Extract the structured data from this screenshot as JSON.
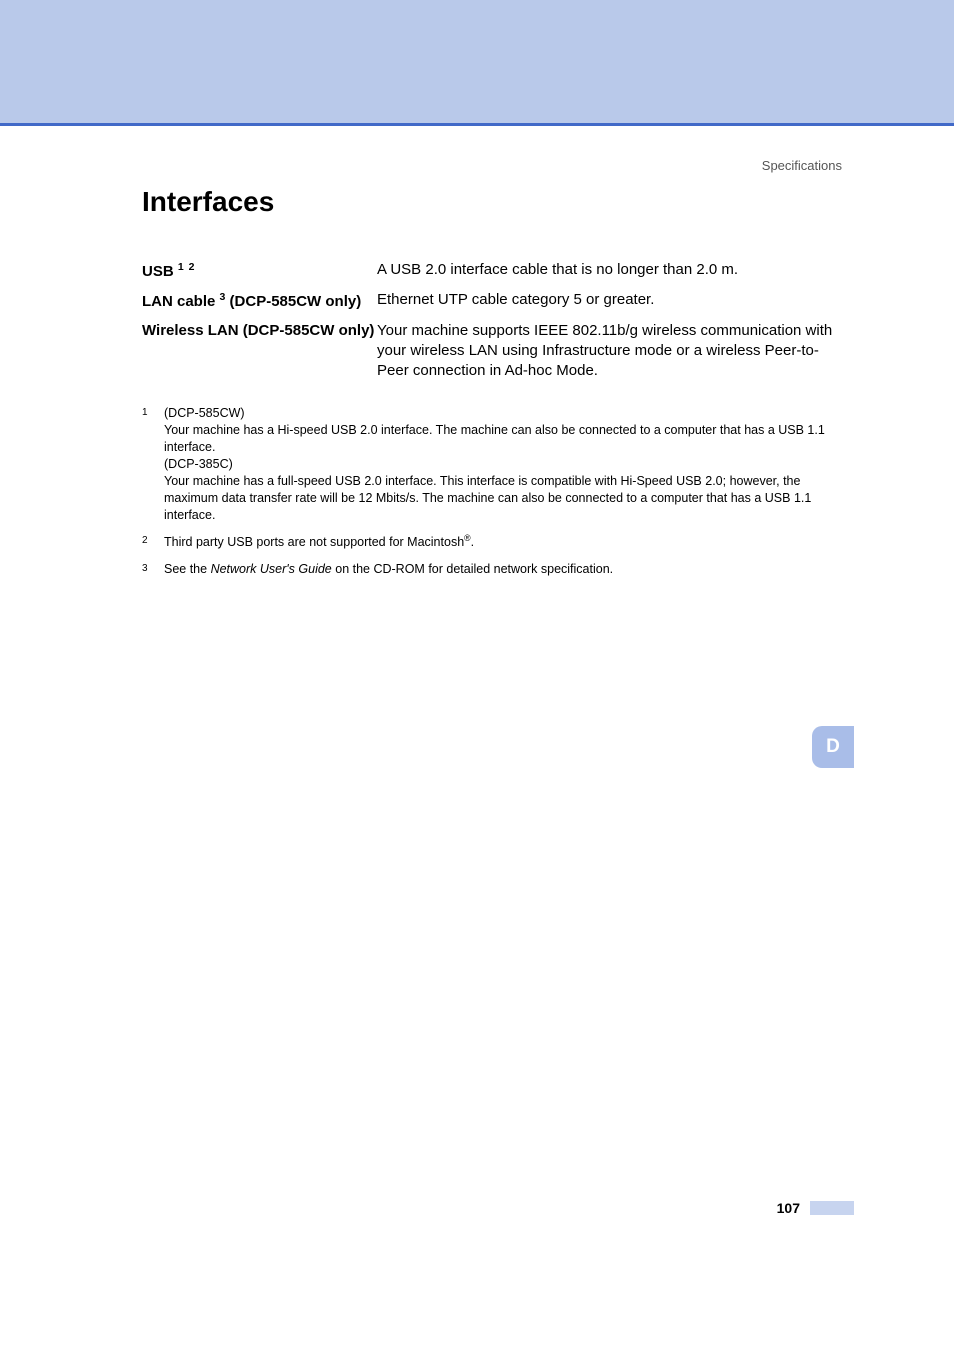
{
  "header": {
    "label": "Specifications"
  },
  "title": "Interfaces",
  "specs": [
    {
      "label": "USB",
      "label_sup": "1 2",
      "value": "A USB 2.0 interface cable that is no longer than 2.0 m."
    },
    {
      "label_pre": "LAN cable",
      "label_sup": "3",
      "label_post": " (DCP-585CW only)",
      "value": "Ethernet UTP cable category 5 or greater."
    },
    {
      "label": "Wireless LAN (DCP-585CW only)",
      "value": "Your machine supports IEEE 802.11b/g wireless communication with your wireless LAN using Infrastructure mode or a wireless Peer-to-Peer connection in Ad-hoc Mode."
    }
  ],
  "footnotes": [
    {
      "num": "1",
      "lines": [
        "(DCP-585CW)",
        "Your machine has a Hi-speed USB 2.0 interface. The machine can also be connected to a computer that has a USB 1.1 interface.",
        "(DCP-385C)",
        "Your machine has a full-speed USB 2.0 interface. This interface is compatible with Hi-Speed USB 2.0; however, the maximum data transfer rate will be 12 Mbits/s. The machine can also be connected to a computer that has a USB 1.1 interface."
      ]
    },
    {
      "num": "2",
      "text_pre": "Third party USB ports are not supported for Macintosh",
      "reg": "®",
      "text_post": "."
    },
    {
      "num": "3",
      "text_pre": "See the ",
      "italic": "Network User's Guide",
      "text_post": " on the CD-ROM for detailed network specification."
    }
  ],
  "section_tab": "D",
  "page_number": "107"
}
